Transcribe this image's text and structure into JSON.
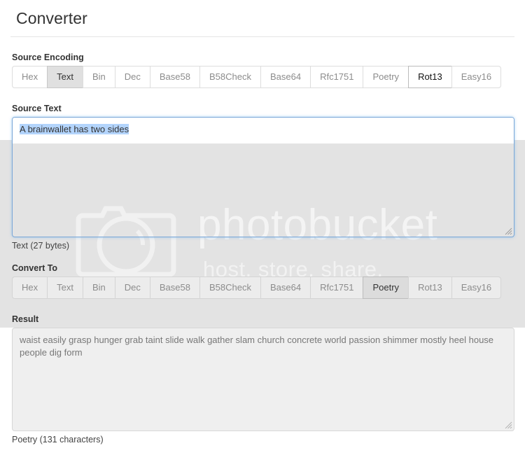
{
  "header": {
    "title": "Converter"
  },
  "source_encoding": {
    "label": "Source Encoding",
    "options": [
      "Hex",
      "Text",
      "Bin",
      "Dec",
      "Base58",
      "B58Check",
      "Base64",
      "Rfc1751",
      "Poetry",
      "Rot13",
      "Easy16"
    ],
    "selected": "Text",
    "hovered": "Rot13"
  },
  "source_text": {
    "label": "Source Text",
    "value": "A brainwallet has two sides",
    "selected_text": "A brainwallet has two sides",
    "helper": "Text (27 bytes)"
  },
  "convert_to": {
    "label": "Convert To",
    "options": [
      "Hex",
      "Text",
      "Bin",
      "Dec",
      "Base58",
      "B58Check",
      "Base64",
      "Rfc1751",
      "Poetry",
      "Rot13",
      "Easy16"
    ],
    "selected": "Poetry"
  },
  "result": {
    "label": "Result",
    "value": "waist easily grasp hunger grab taint slide walk gather slam church concrete world passion shimmer mostly heel house people dig form",
    "helper": "Poetry (131 characters)"
  },
  "watermark": {
    "brand": "photobucket",
    "tagline": "host. store. share.",
    "camera_icon": "camera-icon"
  },
  "colors": {
    "accent_focus": "#7ba7d7",
    "selection": "#b3d4fc",
    "band": "#e3e3e3",
    "active_button": "#e0e0e0"
  }
}
